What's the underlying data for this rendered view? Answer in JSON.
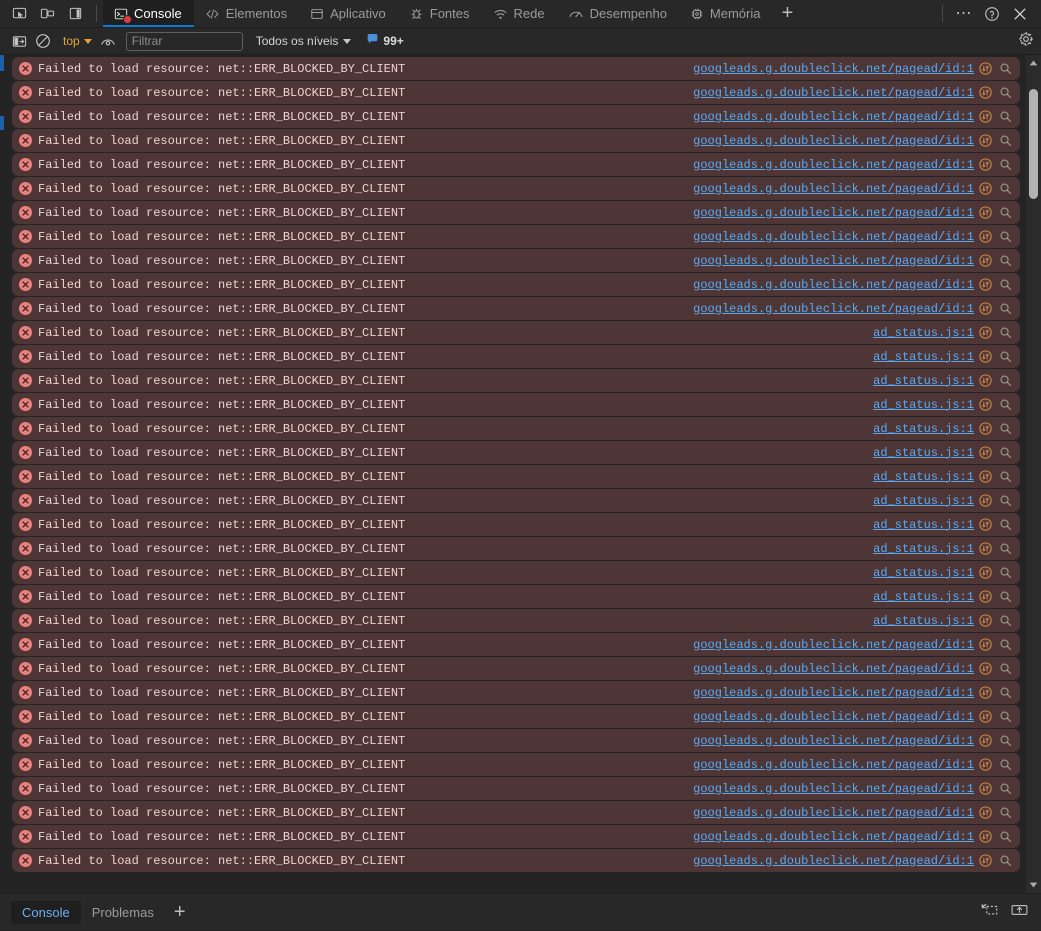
{
  "window": {
    "left_icons": [
      {
        "name": "inspect-element-icon",
        "label": "Inspecionar"
      },
      {
        "name": "device-toolbar-icon",
        "label": "Alternar barra de ferramentas do dispositivo"
      },
      {
        "name": "dock-side-icon",
        "label": "Posicionar painel"
      }
    ],
    "more_label": "…",
    "help_label": "?",
    "close_label": "✕"
  },
  "tabs": [
    {
      "label": "Console",
      "icon": "console-icon",
      "active": true,
      "has_error_badge": true
    },
    {
      "label": "Elementos",
      "icon": "elements-icon",
      "active": false,
      "has_error_badge": false
    },
    {
      "label": "Aplicativo",
      "icon": "application-icon",
      "active": false,
      "has_error_badge": false
    },
    {
      "label": "Fontes",
      "icon": "sources-icon",
      "active": false,
      "has_error_badge": false
    },
    {
      "label": "Rede",
      "icon": "network-icon",
      "active": false,
      "has_error_badge": false
    },
    {
      "label": "Desempenho",
      "icon": "performance-icon",
      "active": false,
      "has_error_badge": false
    },
    {
      "label": "Memória",
      "icon": "memory-icon",
      "active": false,
      "has_error_badge": false
    }
  ],
  "tab_add_label": "+",
  "toolbar": {
    "sidebar_toggle_name": "console-sidebar-icon",
    "clear_console_name": "clear-console-icon",
    "context_value": "top",
    "eye_name": "live-expression-icon",
    "filter_placeholder": "Filtrar",
    "filter_value": "",
    "levels_label": "Todos os níveis",
    "issues_count": "99+",
    "settings_name": "gear-icon"
  },
  "colors": {
    "error_row_bg": "#4e3636",
    "error_text": "#f0d2d2",
    "link": "#5aaaf2",
    "accent_blue": "#0c7bd4",
    "context_amber": "#e8a33d",
    "panel_bg": "#242424",
    "toolbar_bg": "#282828",
    "issue_badge": "#4f8fe0"
  },
  "messages": {
    "text": "Failed to load resource: net::ERR_BLOCKED_BY_CLIENT",
    "level": "error",
    "source_a": "googleads.g.doubleclick.net/pagead/id:1",
    "source_b": "ad_status.js:1",
    "rows": [
      {
        "source": "googleads.g.doubleclick.net/pagead/id:1"
      },
      {
        "source": "googleads.g.doubleclick.net/pagead/id:1"
      },
      {
        "source": "googleads.g.doubleclick.net/pagead/id:1"
      },
      {
        "source": "googleads.g.doubleclick.net/pagead/id:1"
      },
      {
        "source": "googleads.g.doubleclick.net/pagead/id:1"
      },
      {
        "source": "googleads.g.doubleclick.net/pagead/id:1"
      },
      {
        "source": "googleads.g.doubleclick.net/pagead/id:1"
      },
      {
        "source": "googleads.g.doubleclick.net/pagead/id:1"
      },
      {
        "source": "googleads.g.doubleclick.net/pagead/id:1"
      },
      {
        "source": "googleads.g.doubleclick.net/pagead/id:1"
      },
      {
        "source": "googleads.g.doubleclick.net/pagead/id:1"
      },
      {
        "source": "ad_status.js:1"
      },
      {
        "source": "ad_status.js:1"
      },
      {
        "source": "ad_status.js:1"
      },
      {
        "source": "ad_status.js:1"
      },
      {
        "source": "ad_status.js:1"
      },
      {
        "source": "ad_status.js:1"
      },
      {
        "source": "ad_status.js:1"
      },
      {
        "source": "ad_status.js:1"
      },
      {
        "source": "ad_status.js:1"
      },
      {
        "source": "ad_status.js:1"
      },
      {
        "source": "ad_status.js:1"
      },
      {
        "source": "ad_status.js:1"
      },
      {
        "source": "ad_status.js:1"
      },
      {
        "source": "googleads.g.doubleclick.net/pagead/id:1"
      },
      {
        "source": "googleads.g.doubleclick.net/pagead/id:1"
      },
      {
        "source": "googleads.g.doubleclick.net/pagead/id:1"
      },
      {
        "source": "googleads.g.doubleclick.net/pagead/id:1"
      },
      {
        "source": "googleads.g.doubleclick.net/pagead/id:1"
      },
      {
        "source": "googleads.g.doubleclick.net/pagead/id:1"
      },
      {
        "source": "googleads.g.doubleclick.net/pagead/id:1"
      },
      {
        "source": "googleads.g.doubleclick.net/pagead/id:1"
      },
      {
        "source": "googleads.g.doubleclick.net/pagead/id:1"
      },
      {
        "source": "googleads.g.doubleclick.net/pagead/id:1"
      }
    ]
  },
  "drawer": {
    "tabs": [
      {
        "label": "Console",
        "active": true
      },
      {
        "label": "Problemas",
        "active": false
      }
    ],
    "add_label": "+",
    "right_icons": [
      {
        "name": "screenshot-node-icon"
      },
      {
        "name": "export-icon"
      }
    ]
  }
}
